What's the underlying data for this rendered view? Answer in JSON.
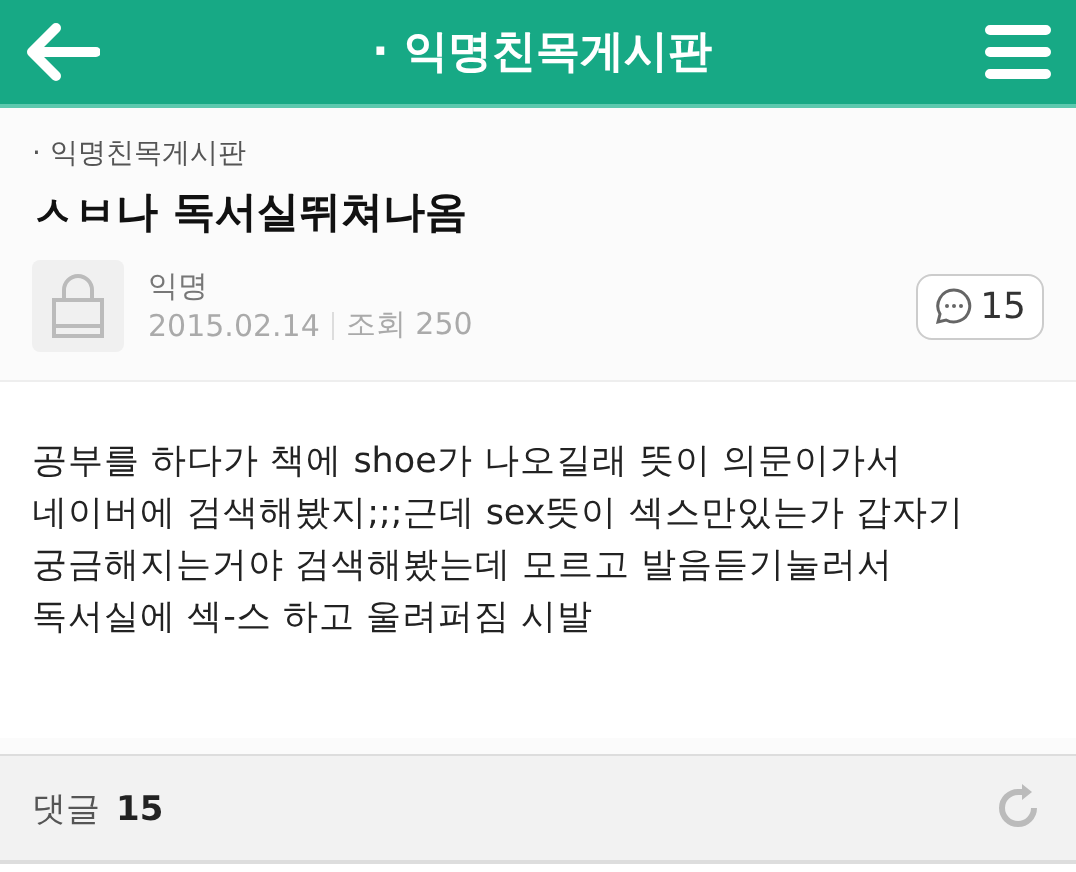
{
  "header": {
    "title": "· 익명친목게시판"
  },
  "post": {
    "board": "· 익명친목게시판",
    "title": "ㅅㅂ나 독서실뛰쳐나옴",
    "author": "익명",
    "date": "2015.02.14",
    "views": "조회 250",
    "comment_count": "15",
    "body": "공부를 하다가 책에 shoe가 나오길래 뜻이 의문이가서 네이버에 검색해봤지;;;근데 sex뜻이 섹스만있는가 갑자기 궁금해지는거야 검색해봤는데 모르고 발음듣기눌러서 독서실에 섹-스 하고 울려퍼짐 시발"
  },
  "footer": {
    "label": "댓글",
    "count": "15"
  }
}
